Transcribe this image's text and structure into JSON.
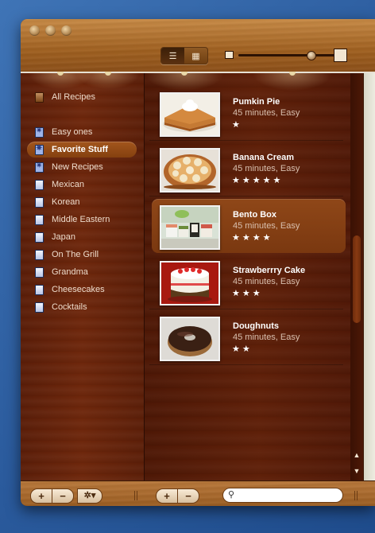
{
  "view_toggle": {
    "list_icon": "list-view-icon",
    "grid_icon": "grid-view-icon"
  },
  "sidebar": {
    "items": [
      {
        "label": "All Recipes",
        "icon": "recipe-book-icon",
        "kind": "all"
      },
      {
        "label": "Easy ones",
        "icon": "smart-folder-icon",
        "kind": "smart"
      },
      {
        "label": "Favorite Stuff",
        "icon": "smart-folder-icon",
        "kind": "smart",
        "selected": true
      },
      {
        "label": "New Recipes",
        "icon": "smart-folder-icon",
        "kind": "smart"
      },
      {
        "label": "Mexican",
        "icon": "notebook-icon",
        "kind": "book"
      },
      {
        "label": "Korean",
        "icon": "notebook-icon",
        "kind": "book"
      },
      {
        "label": "Middle Eastern",
        "icon": "notebook-icon",
        "kind": "book"
      },
      {
        "label": "Japan",
        "icon": "notebook-icon",
        "kind": "book"
      },
      {
        "label": "On The Grill",
        "icon": "notebook-icon",
        "kind": "book"
      },
      {
        "label": "Grandma",
        "icon": "notebook-icon",
        "kind": "book"
      },
      {
        "label": "Cheesecakes",
        "icon": "notebook-icon",
        "kind": "book"
      },
      {
        "label": "Cocktails",
        "icon": "notebook-icon",
        "kind": "book"
      }
    ]
  },
  "recipes": [
    {
      "name": "Pumkin Pie",
      "meta": "45 minutes, Easy",
      "stars": "★",
      "rating": 1
    },
    {
      "name": "Banana Cream",
      "meta": "45 minutes, Easy",
      "stars": "★★★★★",
      "rating": 5
    },
    {
      "name": "Bento Box",
      "meta": "45 minutes, Easy",
      "stars": "★★★★",
      "rating": 4,
      "selected": true
    },
    {
      "name": "Strawberrry Cake",
      "meta": "45 minutes, Easy",
      "stars": "★★★",
      "rating": 3
    },
    {
      "name": "Doughnuts",
      "meta": "45 minutes, Easy",
      "stars": "★★",
      "rating": 2
    }
  ],
  "bottom": {
    "add": "+",
    "remove": "−",
    "action": "✲▾",
    "search_placeholder": ""
  },
  "colors": {
    "wood_light": "#b9783a",
    "wood_dark": "#5e1f08",
    "selection": "#8f4718"
  }
}
